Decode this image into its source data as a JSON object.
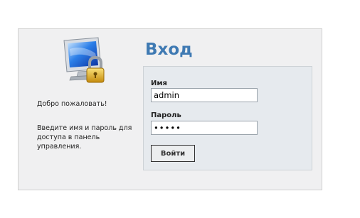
{
  "welcome": "Добро пожаловать!",
  "info": "Введите имя и пароль для доступа в панель управления.",
  "title": "Вход",
  "username": {
    "label": "Имя",
    "value": "admin"
  },
  "password": {
    "label": "Пароль",
    "value": "•••••"
  },
  "submit_label": "Войти",
  "icons": {
    "logo": "computer-lock-icon"
  },
  "colors": {
    "title": "#3f7ab3",
    "panel": "#f0f0f1",
    "form_box": "#e6eaee"
  }
}
